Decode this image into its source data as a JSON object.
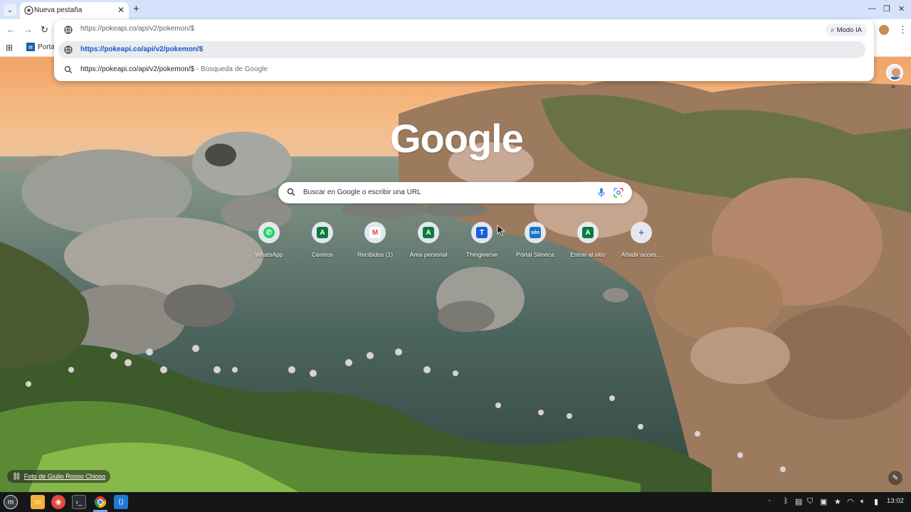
{
  "tab": {
    "title": "Nueva pestaña"
  },
  "omnibox": {
    "input_value": "https://pokeapi.co/api/v2/pokemon/$",
    "modo_ia_label": "Modo IA",
    "suggestion_url": "https://pokeapi.co/api/v2/pokemon/$",
    "suggestion_search_query": "https://pokeapi.co/api/v2/pokemon/$",
    "suggestion_search_suffix": " - Búsqueda de Google"
  },
  "bookmarks": {
    "first_label": "Porta"
  },
  "ntp": {
    "logo": "Google",
    "search_placeholder": "Buscar en Google o escribir una URL",
    "shortcuts": [
      {
        "label": "WhatsApp",
        "icon": "whatsapp-icon",
        "color": "#25D366",
        "glyph": "✆"
      },
      {
        "label": "Centros",
        "icon": "andalucia-icon",
        "color": "#0b7a3b",
        "glyph": "A"
      },
      {
        "label": "Recibidos (1)",
        "icon": "gmail-icon",
        "color": "#ea4335",
        "glyph": "M"
      },
      {
        "label": "Área personal",
        "icon": "andalucia-icon",
        "color": "#0b7a3b",
        "glyph": "A"
      },
      {
        "label": "Thingiverse",
        "icon": "thingiverse-icon",
        "color": "#1e5bd6",
        "glyph": "T"
      },
      {
        "label": "Portal Séneca",
        "icon": "seneca-icon",
        "color": "#1a75c4",
        "glyph": "sén"
      },
      {
        "label": "Entrar al sitio",
        "icon": "andalucia-icon",
        "color": "#0b7a3b",
        "glyph": "A"
      },
      {
        "label": "Añadir acces...",
        "icon": "plus-icon",
        "color": "#e9eef8",
        "glyph": "+"
      }
    ],
    "photo_credit": "Foto de Giulio Rosso Chioso"
  },
  "taskbar": {
    "clock": "13:02"
  }
}
